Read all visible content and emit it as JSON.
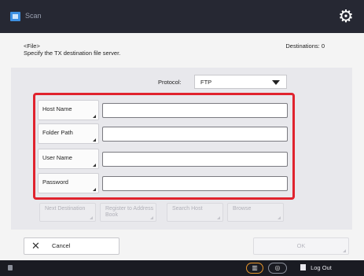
{
  "topbar": {
    "app_name": "Scan"
  },
  "header": {
    "line1": "<File>",
    "line2": "Specify the TX destination file server.",
    "destinations": "Destinations:  0"
  },
  "protocol": {
    "label": "Protocol:",
    "value": "FTP"
  },
  "fields": [
    {
      "label": "Host Name",
      "value": ""
    },
    {
      "label": "Folder Path",
      "value": ""
    },
    {
      "label": "User Name",
      "value": ""
    },
    {
      "label": "Password",
      "value": ""
    }
  ],
  "actions": [
    {
      "label": "Next Destination"
    },
    {
      "label": "Register to Address Book"
    },
    {
      "label": "Search Host"
    },
    {
      "label": "Browse"
    }
  ],
  "footer": {
    "cancel": "Cancel",
    "ok": "OK"
  },
  "statusbar": {
    "logout": "Log Out"
  },
  "colors": {
    "highlight": "#e0232e",
    "topbar": "#262833"
  }
}
